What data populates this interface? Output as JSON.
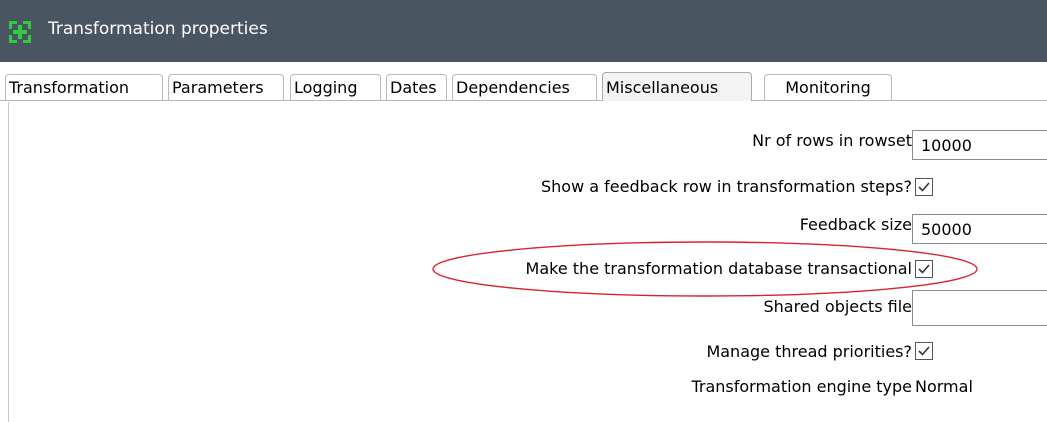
{
  "window": {
    "title": "Transformation properties",
    "icon": "spoon-transformation-icon"
  },
  "tabs": [
    {
      "label": "Transformation"
    },
    {
      "label": "Parameters"
    },
    {
      "label": "Logging"
    },
    {
      "label": "Dates"
    },
    {
      "label": "Dependencies"
    },
    {
      "label": "Miscellaneous",
      "active": true
    },
    {
      "label": "Monitoring"
    }
  ],
  "form": {
    "rowset": {
      "label": "Nr of rows in rowset",
      "value": "10000"
    },
    "feedback_row": {
      "label": "Show a feedback row in transformation steps?",
      "checked": true
    },
    "feedback_size": {
      "label": "Feedback size",
      "value": "50000"
    },
    "transactional": {
      "label": "Make the transformation database transactional",
      "checked": true
    },
    "shared_objects": {
      "label": "Shared objects file",
      "value": ""
    },
    "thread_priorities": {
      "label": "Manage thread priorities?",
      "checked": true
    },
    "engine_type": {
      "label": "Transformation engine type",
      "value": "Normal"
    }
  },
  "colors": {
    "titlebar": "#4a5562",
    "icon_green": "#2ecc40",
    "annotation_ellipse": "#d9242c"
  }
}
